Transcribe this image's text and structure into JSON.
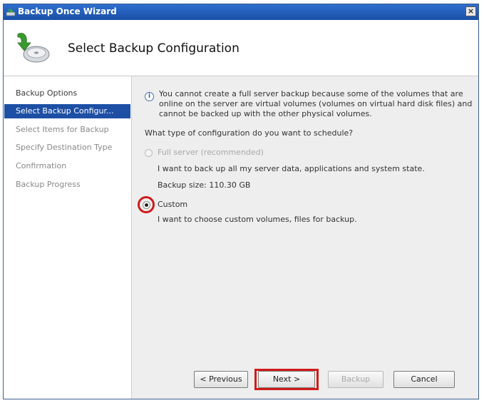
{
  "window": {
    "title": "Backup Once Wizard",
    "close_label": "×"
  },
  "header": {
    "title": "Select Backup Configuration"
  },
  "sidebar": {
    "items": [
      {
        "label": "Backup Options"
      },
      {
        "label": "Select Backup Configur..."
      },
      {
        "label": "Select Items for Backup"
      },
      {
        "label": "Specify Destination Type"
      },
      {
        "label": "Confirmation"
      },
      {
        "label": "Backup Progress"
      }
    ],
    "active_index": 1
  },
  "content": {
    "info_icon": "i",
    "info_text": "You cannot create a full server backup because some of the volumes that are online on the server are virtual volumes (volumes on virtual hard disk files) and cannot be backed up with the other physical volumes.",
    "question": "What type of configuration do you want to schedule?",
    "full_server": {
      "label": "Full server (recommended)",
      "description": "I want to back up all my server data, applications and system state.",
      "size": "Backup size: 110.30 GB",
      "enabled": false,
      "selected": false
    },
    "custom": {
      "label": "Custom",
      "description": "I want to choose custom volumes, files for backup.",
      "enabled": true,
      "selected": true
    }
  },
  "buttons": {
    "previous": "< Previous",
    "next": "Next >",
    "backup": "Backup",
    "cancel": "Cancel"
  },
  "colors": {
    "accent": "#1d4fa5",
    "highlight": "#d11a1a"
  }
}
